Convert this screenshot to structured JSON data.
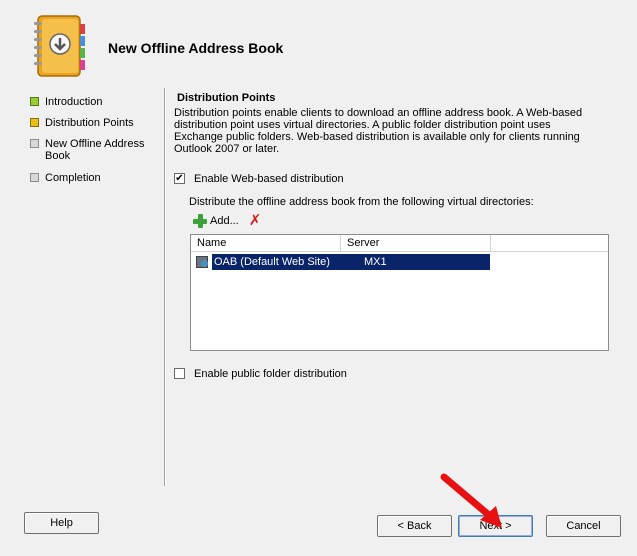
{
  "header": {
    "title": "New Offline Address Book"
  },
  "nav": {
    "items": [
      {
        "label": "Introduction",
        "state": "complete",
        "color": "#9acd32"
      },
      {
        "label": "Distribution Points",
        "state": "current",
        "color": "#e8c020"
      },
      {
        "label": "New Offline Address Book",
        "state": "pending",
        "color": "#d8d8d8"
      },
      {
        "label": "Completion",
        "state": "pending",
        "color": "#d8d8d8"
      }
    ]
  },
  "content": {
    "section_title": "Distribution Points",
    "description": "Distribution points enable clients to download an offline address book. A Web-based distribution point uses virtual directories. A public folder distribution point uses Exchange public folders. Web-based distribution is available only for clients running Outlook 2007 or later.",
    "web_checkbox": {
      "label": "Enable Web-based distribution",
      "checked": true
    },
    "distribute_label": "Distribute the offline address book from the following virtual directories:",
    "add_label": "Add...",
    "list": {
      "columns": [
        "Name",
        "Server"
      ],
      "rows": [
        {
          "name": "OAB (Default Web Site)",
          "server": "MX1",
          "selected": true
        }
      ]
    },
    "public_checkbox": {
      "label": "Enable public folder distribution",
      "checked": false
    }
  },
  "buttons": {
    "help": "Help",
    "back": "< Back",
    "next": "Next >",
    "cancel": "Cancel"
  },
  "colors": {
    "selection": "#0a246a",
    "arrow": "#e81010"
  },
  "checkmark": "✔"
}
